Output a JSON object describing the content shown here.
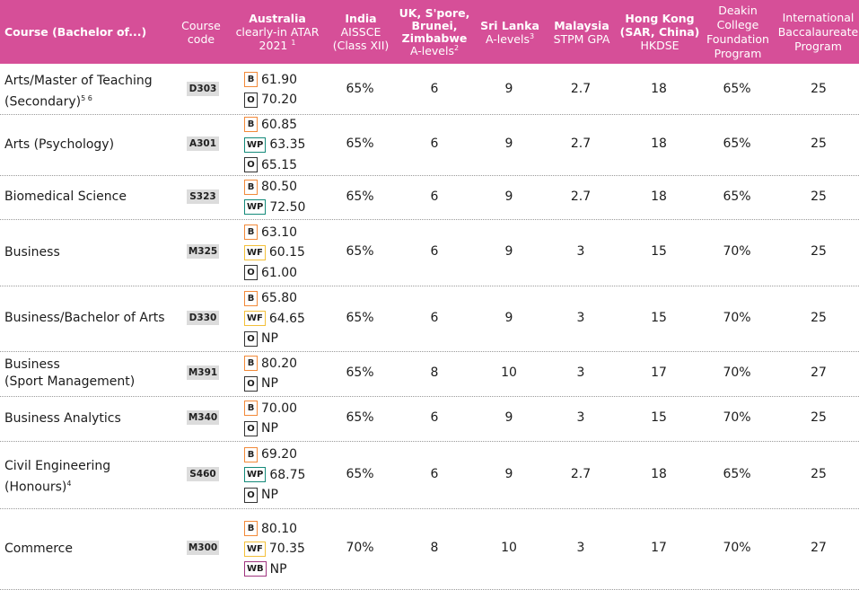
{
  "headers": {
    "course": "Course (Bachelor of...)",
    "code": [
      "Course",
      "code"
    ],
    "australia": {
      "title": "Australia",
      "sub": "clearly-in ATAR",
      "year": "2021",
      "sup": "1"
    },
    "india": {
      "title": "India",
      "sub1": "AISSCE",
      "sub2": "(Class XII)"
    },
    "uk": {
      "title1": "UK, S'pore,",
      "title2": "Brunei,",
      "title3": "Zimbabwe",
      "sub": "A-levels",
      "sup": "2"
    },
    "srilanka": {
      "title": "Sri Lanka",
      "sub": "A-levels",
      "sup": "3"
    },
    "malaysia": {
      "title": "Malaysia",
      "sub": "STPM GPA"
    },
    "hongkong": {
      "title1": "Hong Kong",
      "title2": "(SAR, China)",
      "sub": "HKDSE"
    },
    "deakin": {
      "l1": "Deakin",
      "l2": "College",
      "l3": "Foundation",
      "l4": "Program"
    },
    "ib": {
      "l1": "International",
      "l2": "Baccalaureate",
      "l3": "Program"
    }
  },
  "rows": [
    {
      "course1": "Arts/Master of Teaching",
      "course2": "(Secondary)",
      "sup": "5 6",
      "code": "D303",
      "atar": [
        {
          "b": "B",
          "v": "61.90"
        },
        {
          "b": "O",
          "v": "70.20"
        }
      ],
      "india": "65%",
      "uk": "6",
      "sl": "9",
      "my": "2.7",
      "hk": "18",
      "dc": "65%",
      "ib": "25"
    },
    {
      "course1": "Arts (Psychology)",
      "course2": "",
      "sup": "",
      "code": "A301",
      "atar": [
        {
          "b": "B",
          "v": "60.85"
        },
        {
          "b": "WP",
          "v": "63.35"
        },
        {
          "b": "O",
          "v": "65.15"
        }
      ],
      "india": "65%",
      "uk": "6",
      "sl": "9",
      "my": "2.7",
      "hk": "18",
      "dc": "65%",
      "ib": "25"
    },
    {
      "course1": "Biomedical Science",
      "course2": "",
      "sup": "",
      "code": "S323",
      "atar": [
        {
          "b": "B",
          "v": "80.50"
        },
        {
          "b": "WP",
          "v": "72.50"
        }
      ],
      "india": "65%",
      "uk": "6",
      "sl": "9",
      "my": "2.7",
      "hk": "18",
      "dc": "65%",
      "ib": "25"
    },
    {
      "course1": "Business",
      "course2": "",
      "sup": "",
      "code": "M325",
      "atar": [
        {
          "b": "B",
          "v": "63.10"
        },
        {
          "b": "WF",
          "v": "60.15"
        },
        {
          "b": "O",
          "v": "61.00"
        }
      ],
      "india": "65%",
      "uk": "6",
      "sl": "9",
      "my": "3",
      "hk": "15",
      "dc": "70%",
      "ib": "25"
    },
    {
      "course1": "Business/Bachelor of Arts",
      "course2": "",
      "sup": "",
      "code": "D330",
      "atar": [
        {
          "b": "B",
          "v": "65.80"
        },
        {
          "b": "WF",
          "v": "64.65"
        },
        {
          "b": "O",
          "v": "NP"
        }
      ],
      "india": "65%",
      "uk": "6",
      "sl": "9",
      "my": "3",
      "hk": "15",
      "dc": "70%",
      "ib": "25"
    },
    {
      "course1": "Business",
      "course2": "(Sport Management)",
      "sup": "",
      "code": "M391",
      "atar": [
        {
          "b": "B",
          "v": "80.20"
        },
        {
          "b": "O",
          "v": "NP"
        }
      ],
      "india": "65%",
      "uk": "8",
      "sl": "10",
      "my": "3",
      "hk": "17",
      "dc": "70%",
      "ib": "27"
    },
    {
      "course1": "Business Analytics",
      "course2": "",
      "sup": "",
      "code": "M340",
      "atar": [
        {
          "b": "B",
          "v": "70.00"
        },
        {
          "b": "O",
          "v": "NP"
        }
      ],
      "india": "65%",
      "uk": "6",
      "sl": "9",
      "my": "3",
      "hk": "15",
      "dc": "70%",
      "ib": "25"
    },
    {
      "course1": "Civil Engineering",
      "course2": "(Honours)",
      "sup": "4",
      "code": "S460",
      "atar": [
        {
          "b": "B",
          "v": "69.20"
        },
        {
          "b": "WP",
          "v": "68.75"
        },
        {
          "b": "O",
          "v": "NP"
        }
      ],
      "india": "65%",
      "uk": "6",
      "sl": "9",
      "my": "2.7",
      "hk": "18",
      "dc": "65%",
      "ib": "25"
    },
    {
      "course1": "Commerce",
      "course2": "",
      "sup": "",
      "code": "M300",
      "atar": [
        {
          "b": "B",
          "v": "80.10"
        },
        {
          "b": "WF",
          "v": "70.35"
        },
        {
          "b": "WB",
          "v": "NP"
        }
      ],
      "india": "70%",
      "uk": "8",
      "sl": "10",
      "my": "3",
      "hk": "17",
      "dc": "70%",
      "ib": "27"
    }
  ],
  "badge_labels": {
    "B": "B",
    "O": "O",
    "WP": "WP",
    "WF": "WF",
    "WB": "WB"
  },
  "colors": {
    "header_bg": "#d64f98",
    "badge_B": "#f28a3a",
    "badge_WP": "#148a7a",
    "badge_WF": "#f3c03a",
    "badge_WB": "#a0357f"
  }
}
